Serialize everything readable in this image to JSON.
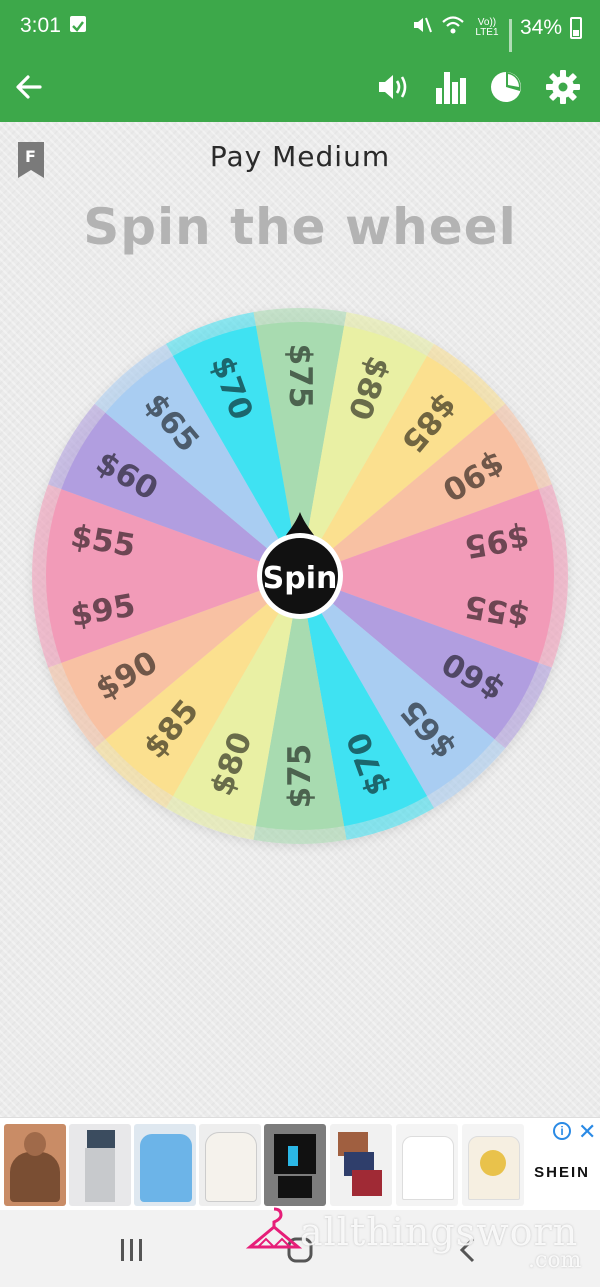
{
  "status_bar": {
    "time": "3:01",
    "network_label": "Vo)) LTE1",
    "battery_percent": "34%",
    "icons": [
      "notification-check-icon",
      "mute-icon",
      "wifi-icon",
      "signal-icon",
      "battery-icon"
    ]
  },
  "app_bar": {
    "icons": [
      "back-arrow-icon",
      "sound-icon",
      "stats-icon",
      "pie-chart-icon",
      "settings-gear-icon"
    ],
    "accent_color": "#3da84a"
  },
  "game": {
    "mode_title": "Pay Medium",
    "headline": "Spin the wheel",
    "spin_label": "Spin",
    "mode_badge": "F"
  },
  "wheel": {
    "segments": [
      {
        "label": "$75",
        "color": "#a8dbb0"
      },
      {
        "label": "$80",
        "color": "#e9f0a4"
      },
      {
        "label": "$85",
        "color": "#fbe08f"
      },
      {
        "label": "$90",
        "color": "#f8c1a3"
      },
      {
        "label": "$95",
        "color": "#f29bb8"
      },
      {
        "label": "$55",
        "color": "#f29bb8"
      },
      {
        "label": "$60",
        "color": "#b19ee0"
      },
      {
        "label": "$65",
        "color": "#a9cdf2"
      },
      {
        "label": "$70",
        "color": "#3fe2f2"
      },
      {
        "label": "$75",
        "color": "#a8dbb0"
      },
      {
        "label": "$80",
        "color": "#e9f0a4"
      },
      {
        "label": "$85",
        "color": "#fbe08f"
      },
      {
        "label": "$90",
        "color": "#f8c1a3"
      },
      {
        "label": "$95",
        "color": "#f29bb8"
      },
      {
        "label": "$55",
        "color": "#f29bb8"
      },
      {
        "label": "$60",
        "color": "#b19ee0"
      },
      {
        "label": "$65",
        "color": "#a9cdf2"
      },
      {
        "label": "$70",
        "color": "#3fe2f2"
      }
    ]
  },
  "ad": {
    "brand": "SHEIN",
    "info_label": "i",
    "close_label": "✕"
  },
  "nav_bar": {
    "icons": [
      "recents-icon",
      "home-icon",
      "back-icon"
    ]
  },
  "watermark": {
    "text": "allthingsworn",
    "suffix": ".com"
  }
}
